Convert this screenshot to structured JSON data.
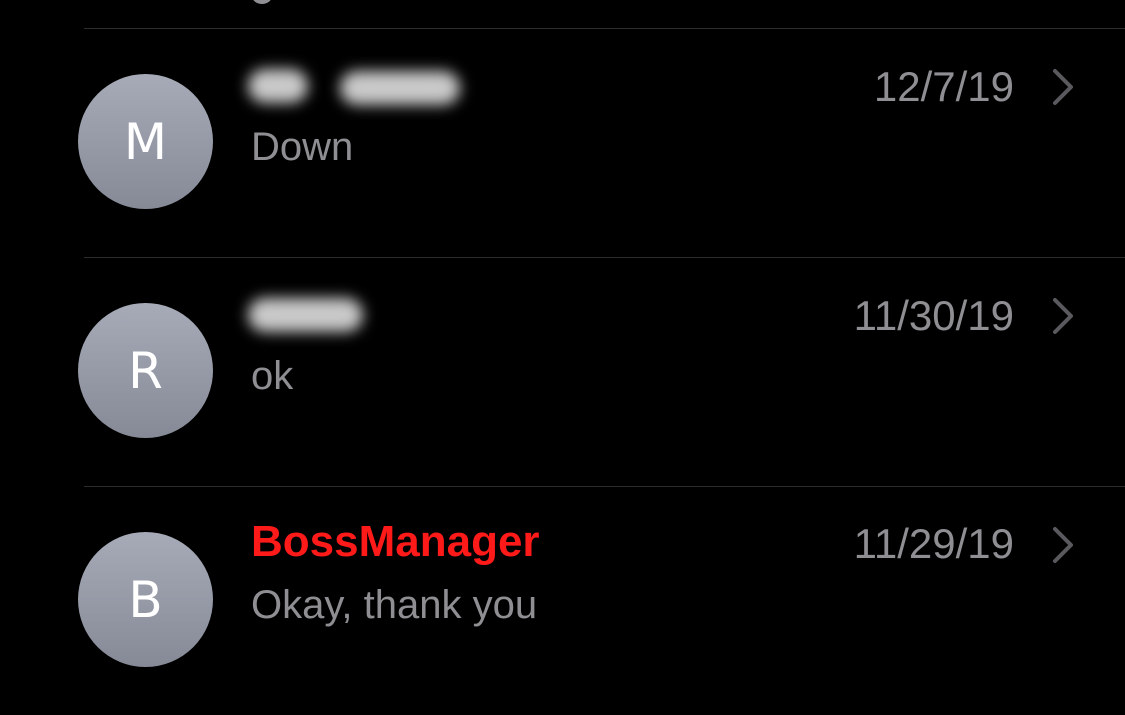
{
  "conversations": [
    {
      "initial": "M",
      "name": "",
      "name_redacted": true,
      "preview": "Down",
      "date": "12/7/19",
      "chevron_icon": "chevron-right-icon"
    },
    {
      "initial": "R",
      "name": "",
      "name_redacted": true,
      "preview": "ok",
      "date": "11/30/19",
      "chevron_icon": "chevron-right-icon"
    },
    {
      "initial": "B",
      "name": "BossManager",
      "name_redacted": false,
      "preview": "Okay, thank you",
      "date": "11/29/19",
      "chevron_icon": "chevron-right-icon"
    }
  ],
  "colors": {
    "background": "#000000",
    "unknown_sender": "#ff1a1a",
    "secondary_text": "#8e8e93",
    "separator": "#2c2c2e"
  }
}
